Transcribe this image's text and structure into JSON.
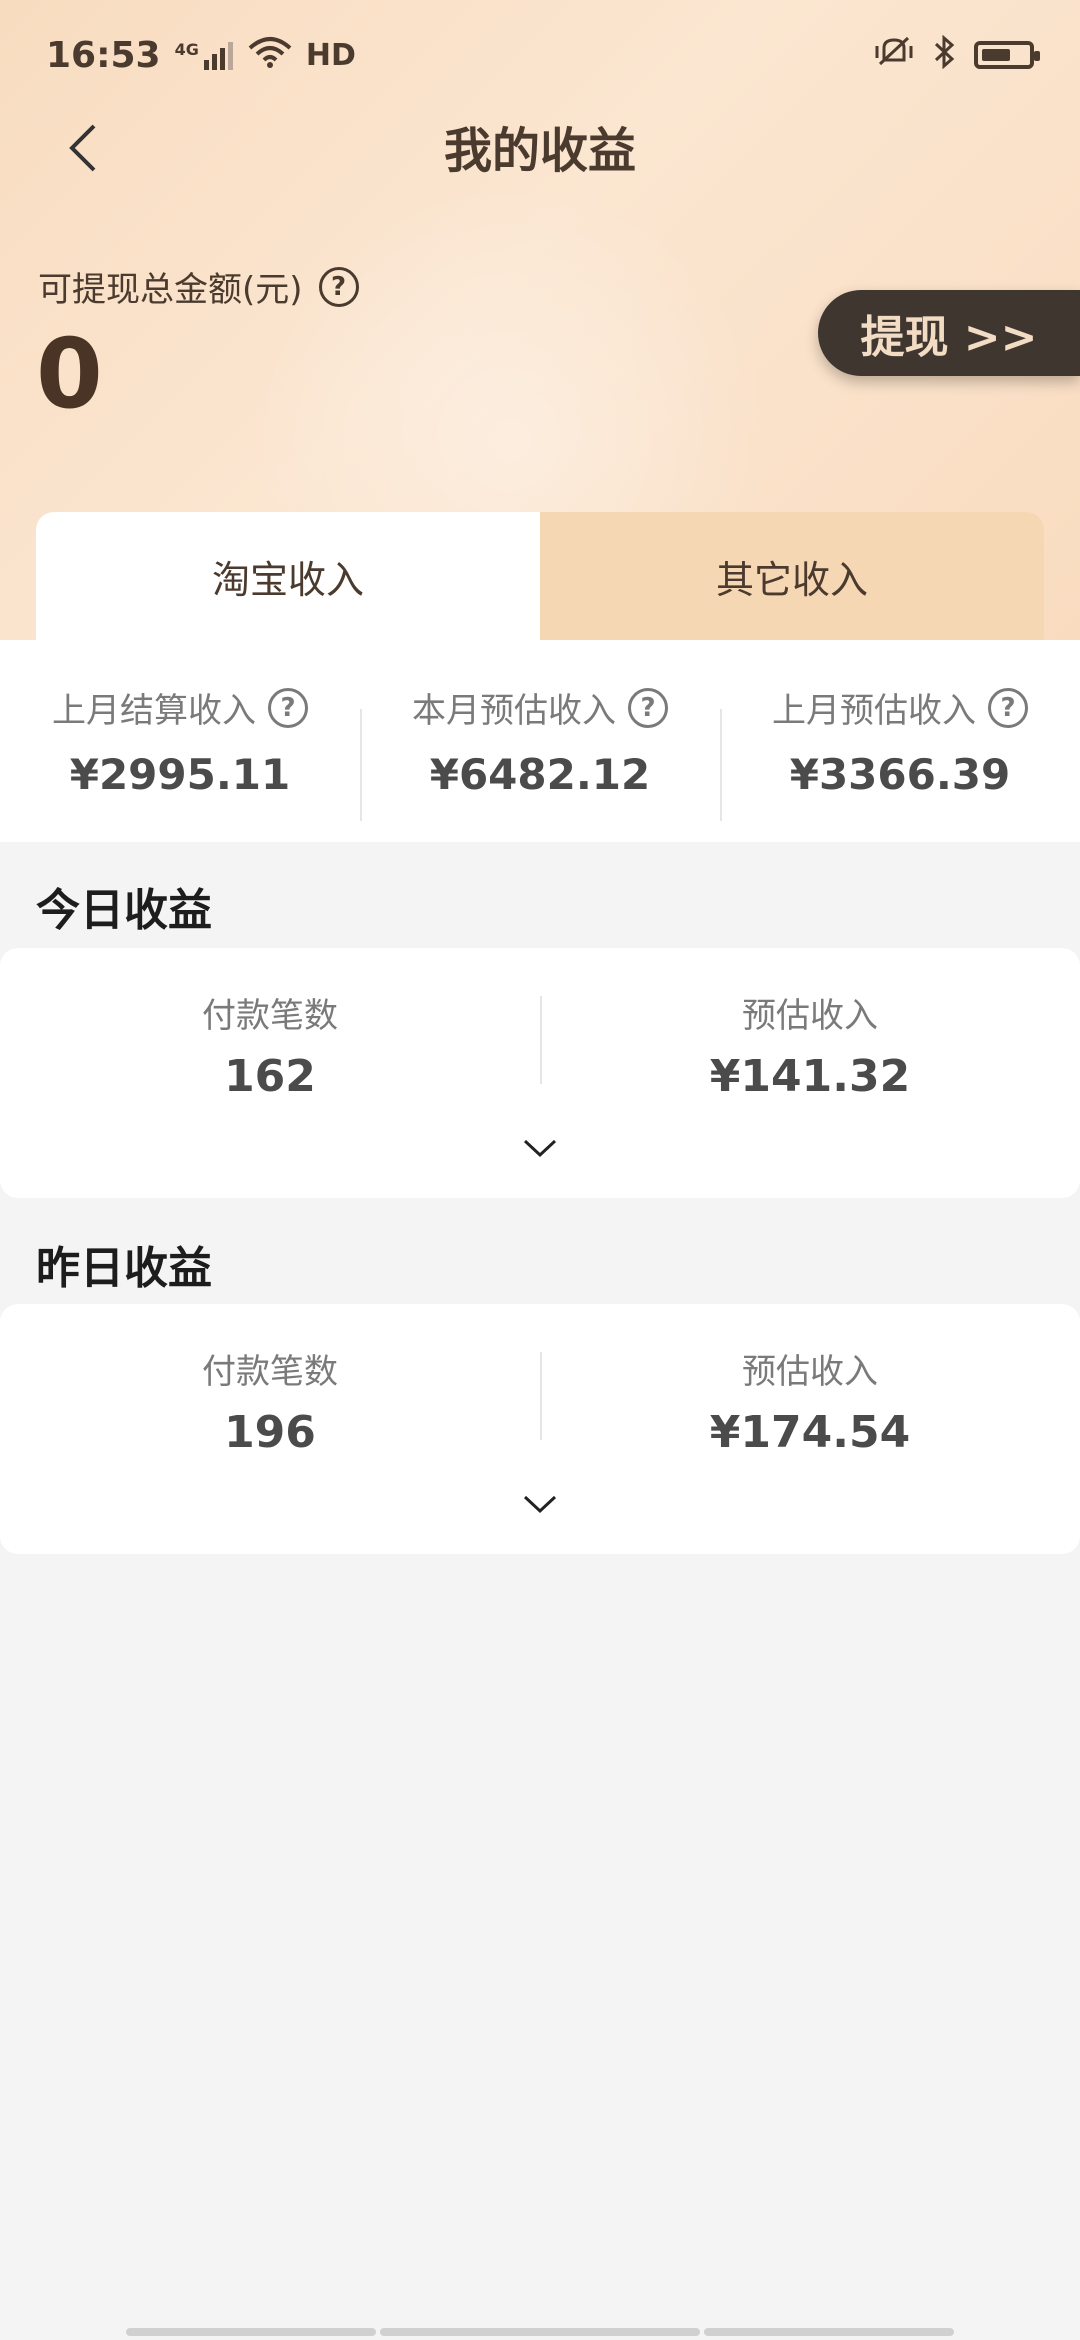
{
  "status_bar": {
    "time": "16:53",
    "network": "4G",
    "hd": "HD"
  },
  "header": {
    "title": "我的收益",
    "back_icon": "chevron-left-icon"
  },
  "balance": {
    "label": "可提现总金额(元)",
    "value": "0",
    "withdraw_label": "提现 >>"
  },
  "tabs": [
    {
      "label": "淘宝收入",
      "active": true
    },
    {
      "label": "其它收入",
      "active": false
    }
  ],
  "monthly_stats": [
    {
      "label": "上月结算收入",
      "value": "¥2995.11"
    },
    {
      "label": "本月预估收入",
      "value": "¥6482.12"
    },
    {
      "label": "上月预估收入",
      "value": "¥3366.39"
    }
  ],
  "today": {
    "title": "今日收益",
    "payment_count_label": "付款笔数",
    "payment_count": "162",
    "estimated_label": "预估收入",
    "estimated": "¥141.32"
  },
  "yesterday": {
    "title": "昨日收益",
    "payment_count_label": "付款笔数",
    "payment_count": "196",
    "estimated_label": "预估收入",
    "estimated": "¥174.54"
  },
  "colors": {
    "brand_brown": "#4b3a2e",
    "withdraw_bg": "#403630",
    "tab_inactive": "#f6d7b4"
  }
}
